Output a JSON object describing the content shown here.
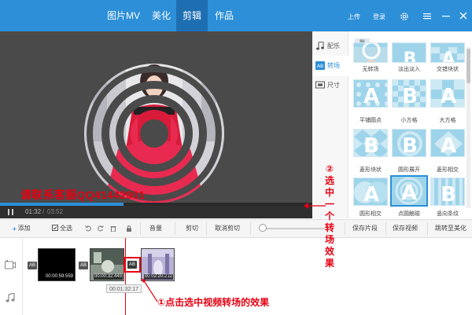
{
  "nav": {
    "tabs": [
      {
        "label": "图片MV"
      },
      {
        "label": "美化"
      },
      {
        "label": "剪辑",
        "active": true
      },
      {
        "label": "作品"
      }
    ],
    "upload": "上传",
    "login": "登录",
    "accent": "#2c8fd8"
  },
  "preview": {
    "time_current": "01:32",
    "time_sep": "/",
    "time_total": "03:52",
    "progress": 0.395,
    "watermark": "请联系客服QQ41442901"
  },
  "side_tabs": [
    {
      "label": "配乐",
      "icon": "music-note-icon"
    },
    {
      "label": "转场",
      "icon": "ab-transition-icon",
      "active": true
    },
    {
      "label": "尺寸",
      "icon": "screen-size-icon"
    }
  ],
  "transitions": {
    "category": "默认",
    "items": [
      {
        "label": "无转场"
      },
      {
        "label": "淡出淡入"
      },
      {
        "label": "交错块状"
      },
      {
        "label": "平铺圆点"
      },
      {
        "label": "小方格"
      },
      {
        "label": "大方格"
      },
      {
        "label": "菱形块状"
      },
      {
        "label": "圆形展开"
      },
      {
        "label": "菱形相交"
      },
      {
        "label": "圆形相交"
      },
      {
        "label": "点圆触碰",
        "selected": true
      },
      {
        "label": "竖向条纹"
      }
    ]
  },
  "toolbar": {
    "add": "添加",
    "select_all": "全选",
    "volume": "音量",
    "cut": "剪切",
    "uncut": "取消剪切",
    "save_clip": "保存片段",
    "save_video": "保存视频",
    "jump": "跳转至美化"
  },
  "timeline": {
    "clips": [
      {
        "time": "00:00:59:559"
      },
      {
        "time": "00:00:32:449"
      },
      {
        "time": "00:02:20:212"
      }
    ],
    "ab_label": "AB",
    "playhead_time": "00:01:32:17"
  },
  "annotations": {
    "step1": "①点击选中视频转场的效果",
    "step2": "②选中一个转场效果"
  },
  "colors": {
    "annotation_red": "#e60012",
    "thumb_blue": "#9ed4ea",
    "preview_bg": "#4a4a4a"
  }
}
